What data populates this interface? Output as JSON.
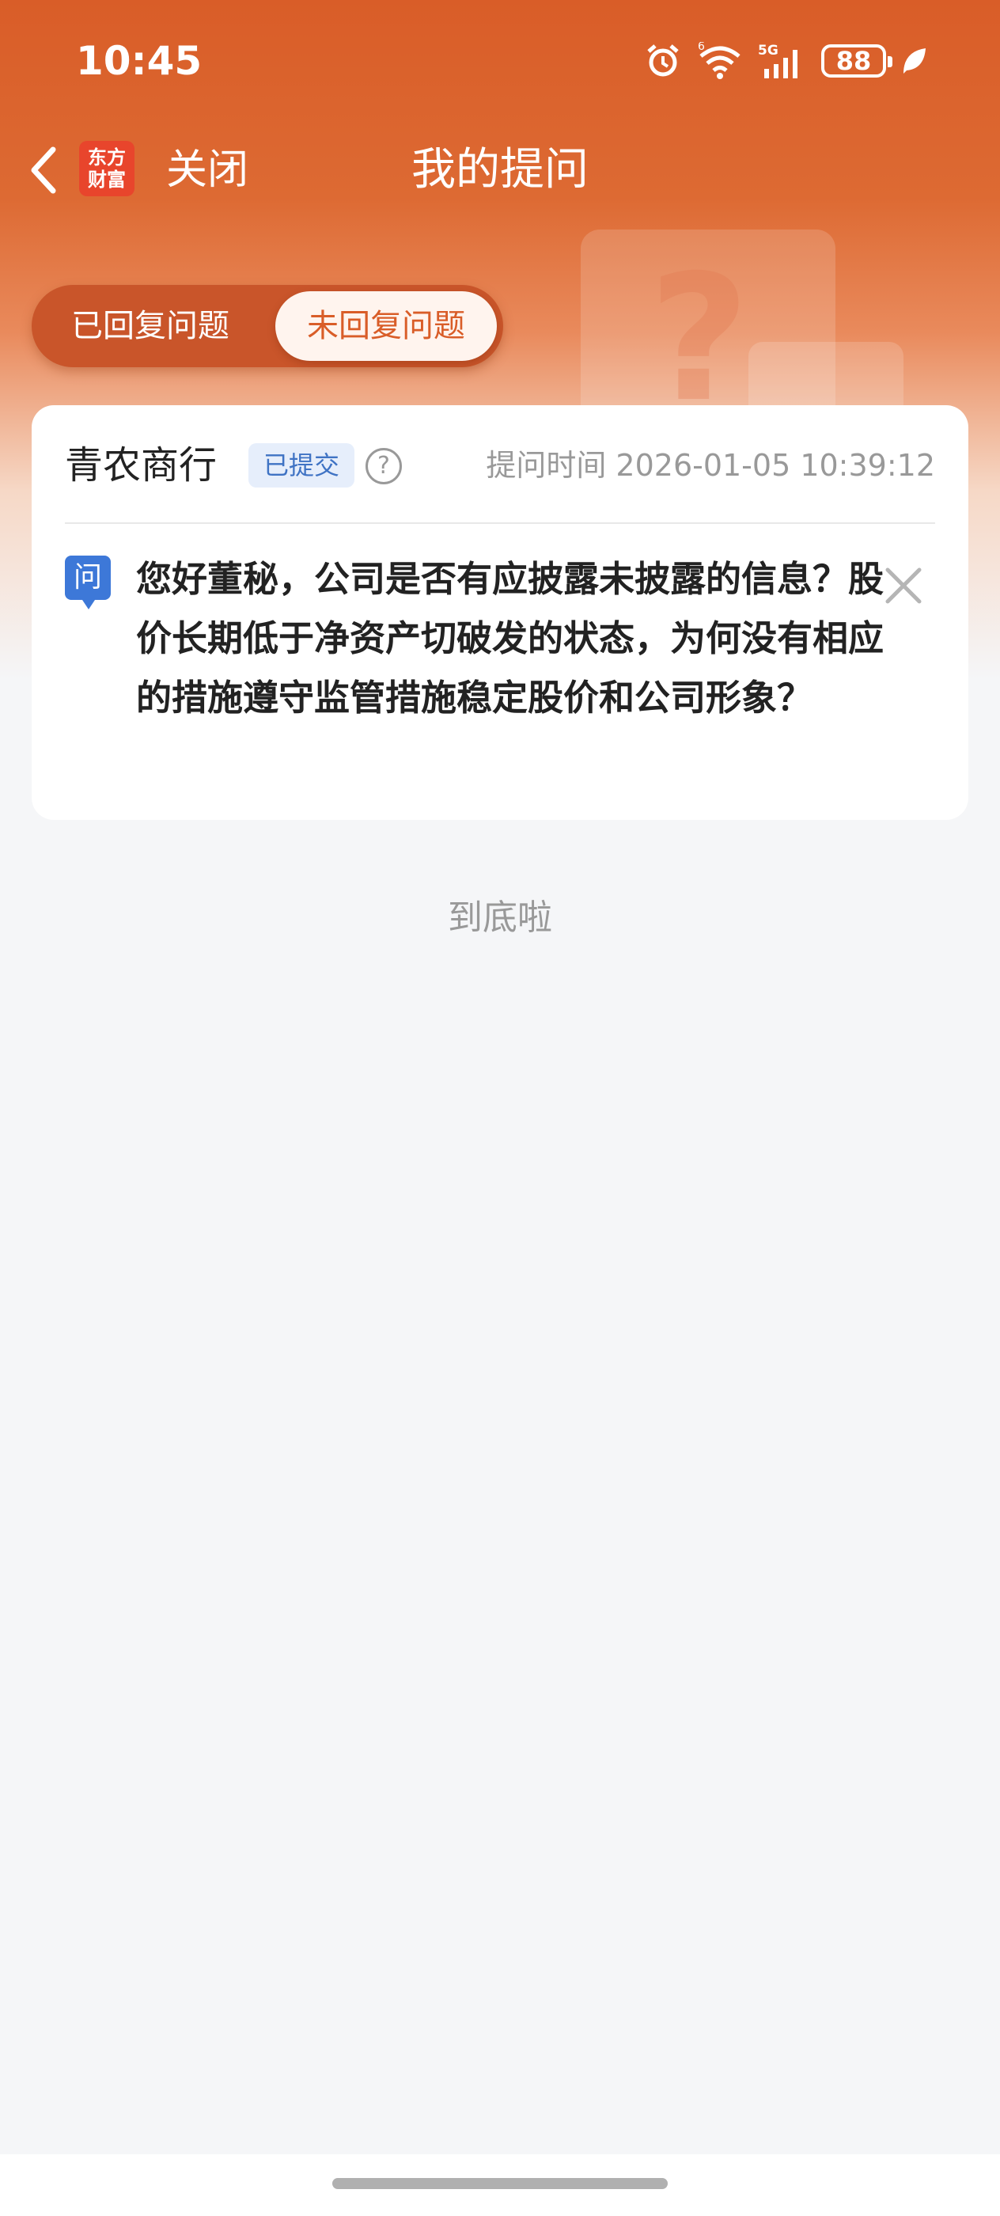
{
  "status_bar": {
    "time": "10:45",
    "network": "5G",
    "wifi_label": "6",
    "battery": "88",
    "icons": [
      "alarm-icon",
      "wifi-icon",
      "signal-icon",
      "battery-icon",
      "leaf-icon"
    ]
  },
  "nav": {
    "logo_line1": "东方",
    "logo_line2": "财富",
    "close_label": "关闭",
    "title": "我的提问"
  },
  "tabs": [
    {
      "label": "已回复问题",
      "active": false
    },
    {
      "label": "未回复问题",
      "active": true
    }
  ],
  "question_card": {
    "company": "青农商行",
    "status": "已提交",
    "ask_time": "提问时间 2026-01-05 10:39:12",
    "question_badge": "问",
    "question": "您好董秘，公司是否有应披露未披露的信息？股价长期低于净资产切破发的状态，为何没有相应的措施遵守监管措施稳定股价和公司形象？"
  },
  "end_text": "到底啦",
  "colors": {
    "brand": "#d95d28",
    "badge_bg": "#e6eefb",
    "badge_text": "#3f73c4",
    "question_icon": "#3d78d8"
  }
}
